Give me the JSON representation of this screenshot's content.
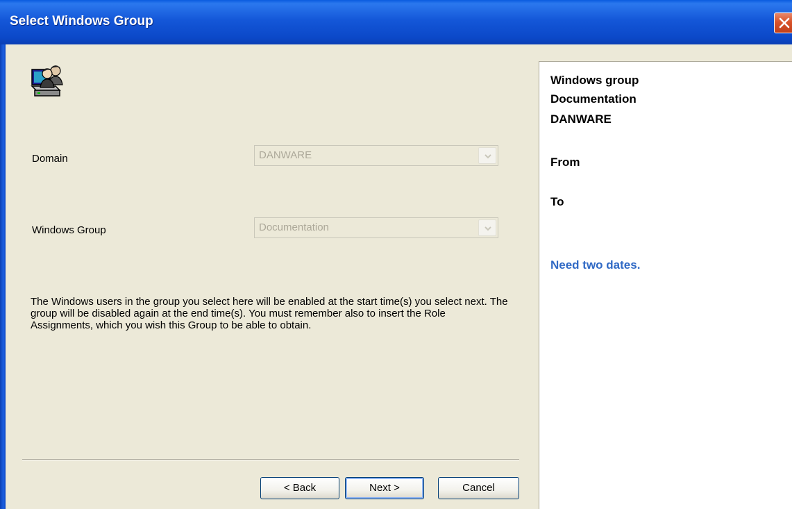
{
  "window": {
    "title": "Select Windows Group"
  },
  "icons": {
    "app_icon": "users-computer-icon",
    "close": "close-icon",
    "dropdown": "chevron-down-icon"
  },
  "colors": {
    "titlebar": "#0b48c8",
    "background": "#ece9d8",
    "warning_text": "#316ac5",
    "close_button": "#d9532a"
  },
  "form": {
    "domain_label": "Domain",
    "domain_value": "DANWARE",
    "group_label": "Windows Group",
    "group_value": "Documentation",
    "description": "The Windows users in the group you select here will be enabled at the start time(s) you select next. The group will be disabled again at the end time(s). You must remember also to insert the Role Assignments, which you wish this Group to be able to obtain."
  },
  "buttons": {
    "back": "< Back",
    "next": "Next >",
    "cancel": "Cancel"
  },
  "summary": {
    "line1": "Windows group",
    "line2": "Documentation",
    "line3": "DANWARE",
    "from_label": "From",
    "to_label": "To",
    "warning": "Need two dates."
  }
}
